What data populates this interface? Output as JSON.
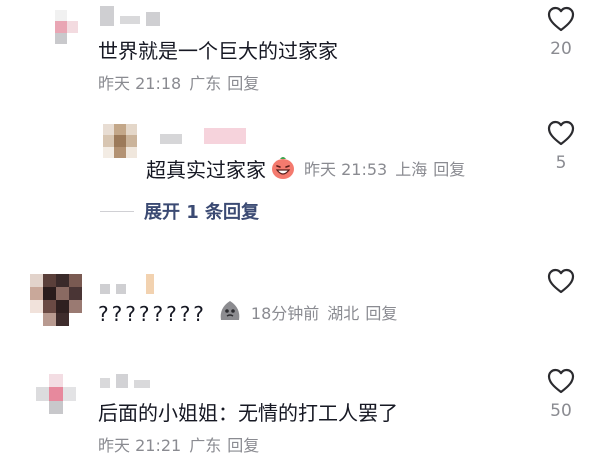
{
  "comments": [
    {
      "text": "世界就是一个巨大的过家家",
      "time": "昨天 21:18",
      "location": "广东",
      "reply_label": "回复",
      "likes": "20",
      "replies_expand": {
        "label": "展开 1 条回复"
      },
      "sub_reply": {
        "text": "超真实过家家",
        "emoji_icon": "laughing-face-emoji",
        "time": "昨天 21:53",
        "location": "上海",
        "reply_label": "回复",
        "likes": "5"
      }
    },
    {
      "text": "????????",
      "emoji_icon": "gray-blob-emoji",
      "time": "18分钟前",
      "location": "湖北",
      "reply_label": "回复",
      "likes": ""
    },
    {
      "text": "后面的小姐姐：无情的打工人罢了",
      "time": "昨天 21:21",
      "location": "广东",
      "reply_label": "回复",
      "likes": "50"
    }
  ],
  "colors": {
    "text": "#161823",
    "meta": "#8a8b91",
    "link": "#3b4a73",
    "icon": "#2b2b2f"
  }
}
